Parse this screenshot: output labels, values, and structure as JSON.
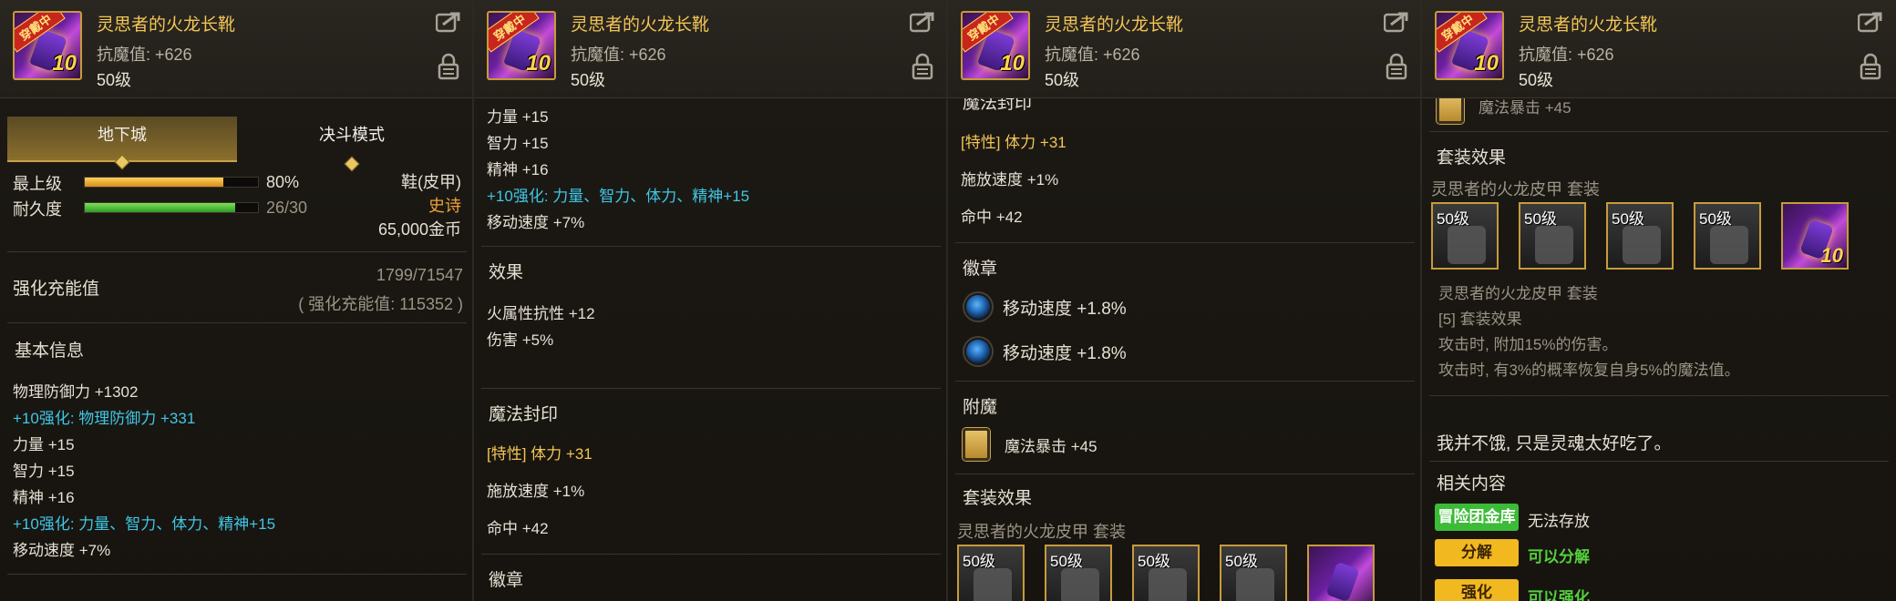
{
  "item": {
    "name": "灵思者的火龙长靴",
    "stat": "抗魔值: +626",
    "level": "50级",
    "equip_tag": "穿戴中",
    "icon_level": "10"
  },
  "p1": {
    "tabs": [
      {
        "label": "地下城"
      },
      {
        "label": "决斗模式"
      }
    ],
    "quality_label": "最上级",
    "quality_value": "80%",
    "quality_fraction": 0.8,
    "durability_label": "耐久度",
    "durability_value": "26/30",
    "durability_fraction": 0.8667,
    "type": "鞋(皮甲)",
    "rarity": "史诗",
    "price": "65,000金币",
    "reinforce_label": "强化充能值",
    "reinforce_value": "1799/71547",
    "reinforce_total": "( 强化充能值: 115352 )",
    "basic_info_title": "基本信息",
    "lines": [
      "物理防御力 +1302",
      "+10强化: 物理防御力 +331",
      "力量 +15",
      "智力 +15",
      "精神 +16",
      "+10强化: 力量、智力、体力、精神+15",
      "移动速度 +7%"
    ]
  },
  "p2": {
    "lines": [
      "力量 +15",
      "智力 +15",
      "精神 +16",
      "+10强化: 力量、智力、体力、精神+15",
      "移动速度 +7%"
    ],
    "effect_title": "效果",
    "effects": [
      "火属性抗性 +12",
      "伤害 +5%"
    ],
    "seal_title": "魔法封印",
    "seal_special": "[特性] 体力 +31",
    "seal_lines": [
      "施放速度 +1%",
      "命中 +42"
    ],
    "emblem_title": "徽章"
  },
  "p3": {
    "top_partial": "魔法封印",
    "seal_special": "[特性] 体力 +31",
    "seal_lines": [
      "施放速度 +1%",
      "命中 +42"
    ],
    "emblem_title": "徽章",
    "emblems": [
      "移动速度 +1.8%",
      "移动速度 +1.8%"
    ],
    "enchant_title": "附魔",
    "enchant": "魔法暴击 +45",
    "set_title": "套装效果",
    "set_name": "灵思者的火龙皮甲  套装",
    "slot_level": "50级"
  },
  "p4": {
    "top_partial": "魔法暴击 +45",
    "set_title": "套装效果",
    "set_name": "灵思者的火龙皮甲  套装",
    "slot_level": "50级",
    "set_name_2": "灵思者的火龙皮甲  套装",
    "set_bonus_title": "[5] 套装效果",
    "set_bonus_lines": [
      "攻击时, 附加15%的伤害。",
      "攻击时, 有3%的概率恢复自身5%的魔法值。"
    ],
    "flavor": "我并不饿, 只是灵魂太好吃了。",
    "related_title": "相关内容",
    "guild_bank_btn": "冒险团金库",
    "guild_bank_text": "无法存放",
    "disassemble_btn": "分解",
    "disassemble_text": "可以分解",
    "bottom_btn": "强化",
    "bottom_text": "可以强化"
  }
}
